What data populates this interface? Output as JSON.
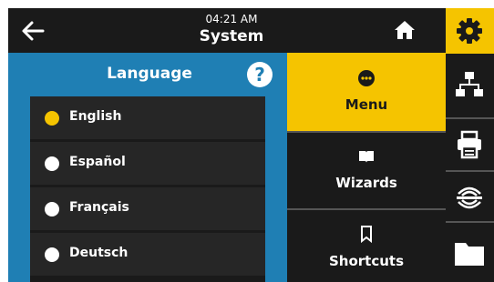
{
  "header": {
    "time": "04:21 AM",
    "title": "System"
  },
  "language_panel": {
    "title": "Language",
    "help_symbol": "?",
    "items": [
      {
        "label": "English",
        "selected": true
      },
      {
        "label": "Español",
        "selected": false
      },
      {
        "label": "Français",
        "selected": false
      },
      {
        "label": "Deutsch",
        "selected": false
      }
    ]
  },
  "menu": {
    "items": [
      {
        "label": "Menu",
        "icon": "dots-menu-icon",
        "active": true
      },
      {
        "label": "Wizards",
        "icon": "book-icon",
        "active": false
      },
      {
        "label": "Shortcuts",
        "icon": "bookmark-icon",
        "active": false
      }
    ]
  },
  "tabs": [
    {
      "icon": "gear-icon",
      "active": true
    },
    {
      "icon": "network-icon",
      "active": false
    },
    {
      "icon": "printer-icon",
      "active": false
    },
    {
      "icon": "rfid-icon",
      "active": false
    },
    {
      "icon": "folder-icon",
      "active": false
    }
  ],
  "colors": {
    "accent": "#f5c400",
    "panel_blue": "#1f7fb4",
    "background": "#1a1a1a"
  }
}
